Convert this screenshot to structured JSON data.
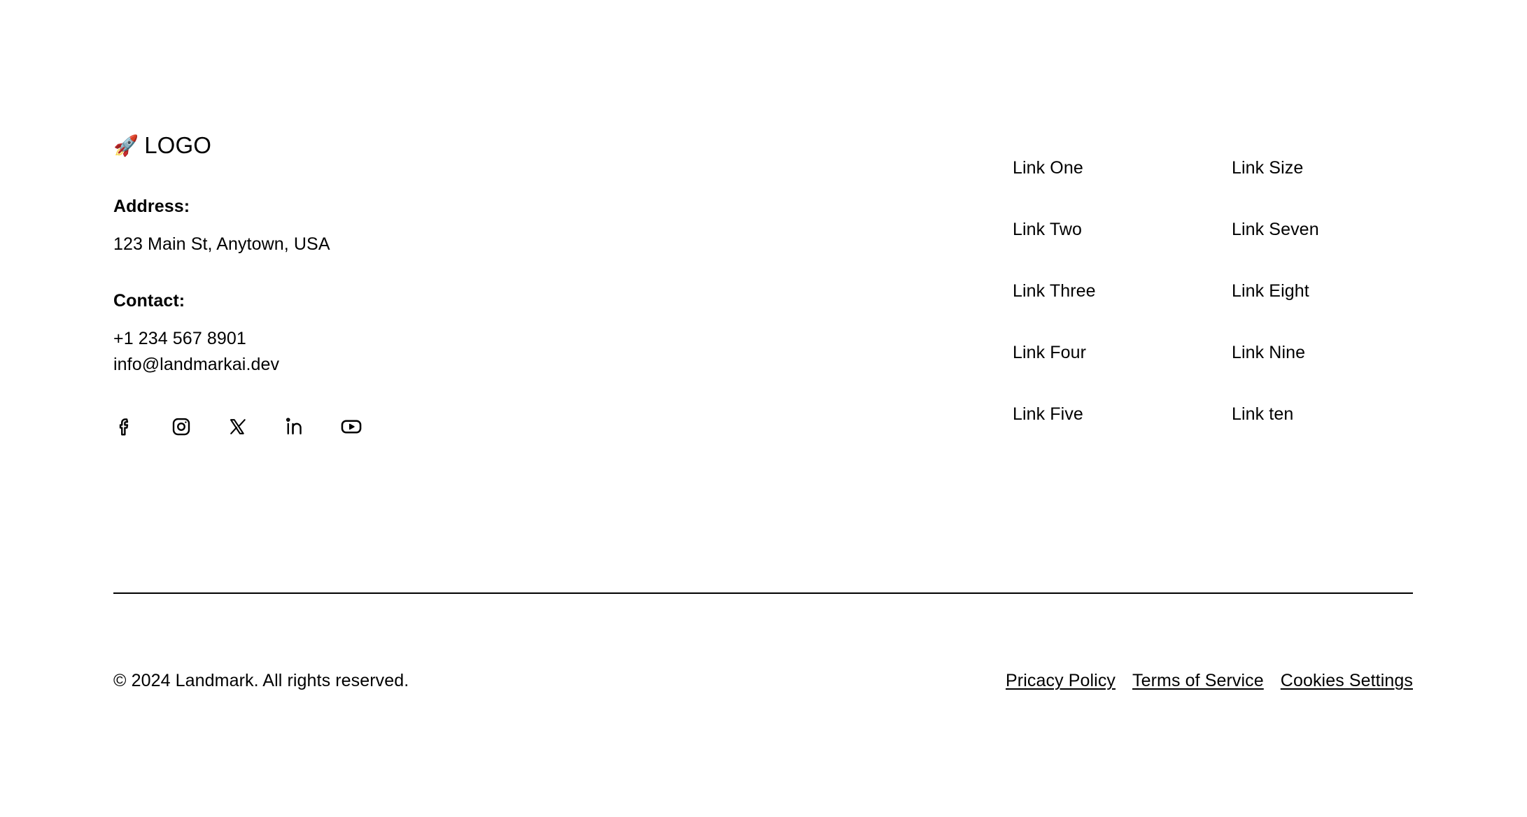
{
  "brand": {
    "logo_emoji": "🚀",
    "logo_text": "LOGO",
    "address_label": "Address:",
    "address_value": "123 Main St, Anytown, USA",
    "contact_label": "Contact:",
    "phone": "+1 234 567 8901",
    "email": "info@landmarkai.dev"
  },
  "socials": [
    {
      "name": "facebook-icon",
      "label": "Facebook"
    },
    {
      "name": "instagram-icon",
      "label": "Instagram"
    },
    {
      "name": "x-twitter-icon",
      "label": "X"
    },
    {
      "name": "linkedin-icon",
      "label": "LinkedIn"
    },
    {
      "name": "youtube-icon",
      "label": "YouTube"
    }
  ],
  "link_columns": [
    {
      "links": [
        {
          "label": "Link One"
        },
        {
          "label": "Link Two"
        },
        {
          "label": "Link Three"
        },
        {
          "label": "Link Four"
        },
        {
          "label": "Link Five"
        }
      ]
    },
    {
      "links": [
        {
          "label": "Link Size"
        },
        {
          "label": "Link Seven"
        },
        {
          "label": "Link Eight"
        },
        {
          "label": "Link Nine"
        },
        {
          "label": "Link ten"
        }
      ]
    }
  ],
  "bottom": {
    "copyright": "© 2024 Landmark. All rights reserved.",
    "legal": [
      {
        "label": "Pricacy Policy"
      },
      {
        "label": "Terms of Service"
      },
      {
        "label": "Cookies Settings"
      }
    ]
  },
  "colors": {
    "background": "#ffffff",
    "text": "#000000",
    "divider": "#000000"
  }
}
